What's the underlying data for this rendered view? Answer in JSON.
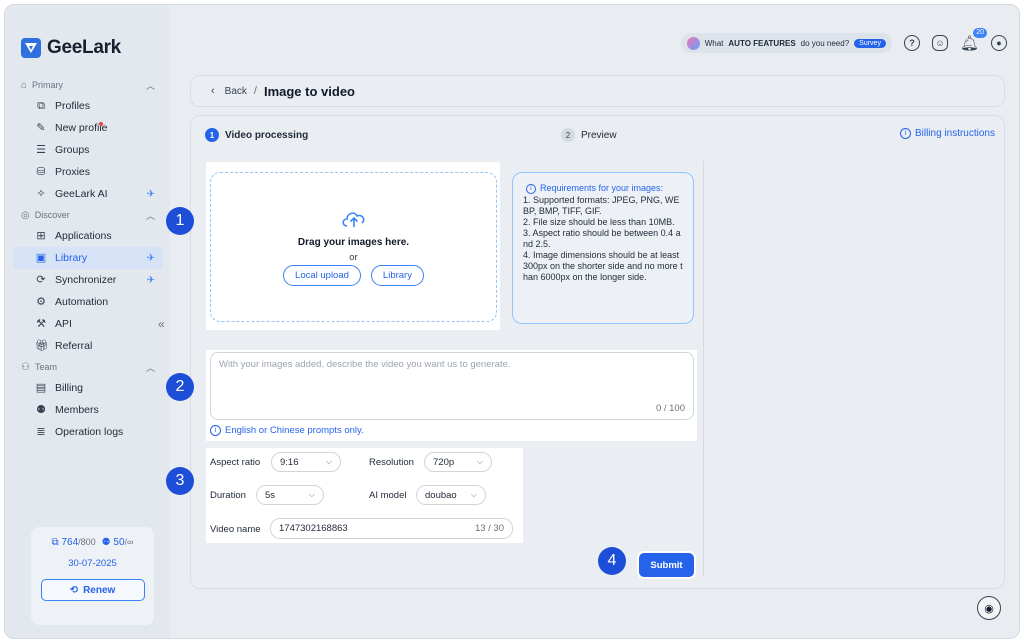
{
  "window": {
    "traffic_colors": [
      "#ff5f57",
      "#febc2e",
      "#28c840"
    ]
  },
  "app": {
    "name": "GeeLark"
  },
  "sidebar": {
    "sections": [
      {
        "label": "Primary",
        "items": [
          {
            "label": "Profiles",
            "icon": "profiles-icon"
          },
          {
            "label": "New profile",
            "icon": "new-profile-icon",
            "dot": true
          },
          {
            "label": "Groups",
            "icon": "groups-icon"
          },
          {
            "label": "Proxies",
            "icon": "proxies-icon"
          },
          {
            "label": "GeeLark AI",
            "icon": "ai-icon",
            "ai": true
          }
        ]
      },
      {
        "label": "Discover",
        "items": [
          {
            "label": "Applications",
            "icon": "applications-icon"
          },
          {
            "label": "Library",
            "icon": "library-icon",
            "ai": true,
            "active": true
          },
          {
            "label": "Synchronizer",
            "icon": "synchronizer-icon",
            "ai": true
          },
          {
            "label": "Automation",
            "icon": "automation-icon"
          },
          {
            "label": "API",
            "icon": "api-icon"
          },
          {
            "label": "Referral",
            "icon": "referral-icon"
          }
        ]
      },
      {
        "label": "Team",
        "items": [
          {
            "label": "Billing",
            "icon": "billing-icon"
          },
          {
            "label": "Members",
            "icon": "members-icon"
          },
          {
            "label": "Operation logs",
            "icon": "operation-logs-icon"
          }
        ]
      }
    ],
    "account": {
      "profiles_used": "764",
      "profiles_total": "/800",
      "members_used": "50",
      "members_total": "/∞",
      "expiry": "30-07-2025",
      "renew_label": "Renew"
    }
  },
  "topbar": {
    "survey_prefix": "What",
    "survey_bold": "AUTO FEATURES",
    "survey_suffix": "do you need?",
    "survey_button": "Survey",
    "notifications_count": "20"
  },
  "header": {
    "back_label": "Back",
    "separator": "/",
    "title": "Image to video"
  },
  "steps": [
    {
      "num": "1",
      "label": "Video processing"
    },
    {
      "num": "2",
      "label": "Preview"
    }
  ],
  "billing_link": "Billing instructions",
  "upload": {
    "title": "Drag your images here.",
    "or": "or",
    "local_upload": "Local upload",
    "library": "Library"
  },
  "requirements": {
    "title": "Requirements for your images:",
    "lines": [
      "1. Supported formats: JPEG, PNG, WEBP, BMP, TIFF, GIF.",
      "2. File size should be less than 10MB.",
      "3. Aspect ratio should be between 0.4 and 2.5.",
      "4. Image dimensions should be at least 300px on the shorter side and no more than 6000px on the longer side."
    ]
  },
  "prompt": {
    "placeholder": "With your images added, describe the video you want us to generate.",
    "count": "0 / 100",
    "hint": "English or Chinese prompts only."
  },
  "params": {
    "aspect_ratio_label": "Aspect ratio",
    "aspect_ratio_value": "9:16",
    "resolution_label": "Resolution",
    "resolution_value": "720p",
    "duration_label": "Duration",
    "duration_value": "5s",
    "ai_model_label": "AI model",
    "ai_model_value": "doubao",
    "video_name_label": "Video name",
    "video_name_value": "1747302168863",
    "video_name_count": "13 / 30"
  },
  "submit_label": "Submit",
  "markers": [
    "1",
    "2",
    "3",
    "4"
  ]
}
